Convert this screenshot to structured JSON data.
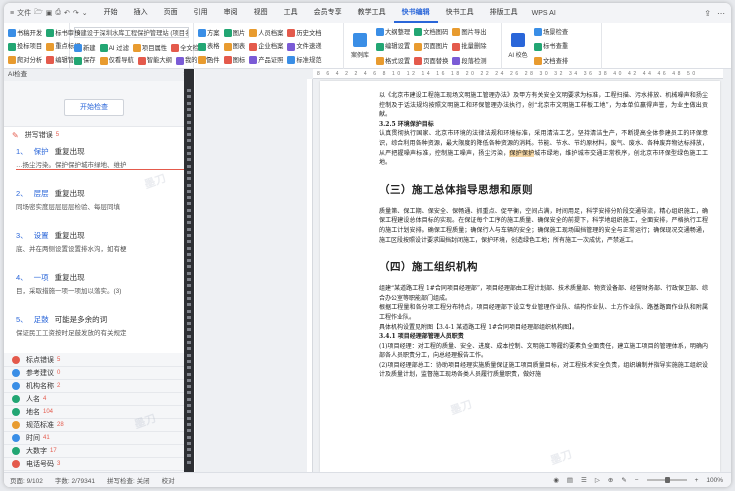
{
  "menubar": {
    "file_label": "文件",
    "tabs": [
      "开始",
      "插入",
      "页面",
      "引用",
      "审阅",
      "视图",
      "工具",
      "会员专享",
      "教学工具",
      "快书编辑",
      "快书工具",
      "排版工具"
    ],
    "active_tab": "快书编辑",
    "wps_ai": "WPS AI"
  },
  "ribbon": {
    "g1": [
      [
        "书稿开发",
        "标书审核"
      ],
      [
        "投标项目",
        "重点标记"
      ],
      [
        "爬对分析",
        "编辑管理"
      ]
    ],
    "g2_title": "快书编辑 (双击选择)",
    "g2_top": "9建设于深圳水库工程保护管理站 (项目名称)",
    "g2_rows": [
      [
        "新建",
        "AI 过滤",
        "项目属性",
        "全文检索"
      ],
      [
        "保存",
        "仅看导航",
        "智能大纲",
        "我的工作"
      ]
    ],
    "g3": [
      [
        "方案",
        "图片",
        "人员档案",
        "历史文档"
      ],
      [
        "表格",
        "图表",
        "企业档案",
        "文件速递"
      ],
      [
        "函件",
        "图标",
        "产品证照",
        "标准规范"
      ]
    ],
    "g4_big": "案例库",
    "g4": [
      [
        "大纲整理",
        "文档图码",
        "图片导出"
      ],
      [
        "编辑设置",
        "页面图片",
        "批量删除"
      ],
      [
        "格式设置",
        "页面替换",
        "段落检测"
      ]
    ],
    "g5_big": "AI 校色",
    "g5": [
      [
        "场景检查"
      ],
      [
        "标书查重"
      ],
      [
        "文档查排"
      ]
    ]
  },
  "panel": {
    "title": "AI检查",
    "close": "×",
    "check_button": "开始检查",
    "spelling_cat": "拼写错误",
    "spelling_count": "5",
    "errors": [
      {
        "num": "1、",
        "word": "保护",
        "type": "重复出现",
        "ctx": "…扬尘污染。保护保护城市绿地、维护"
      },
      {
        "num": "2、",
        "word": "层层",
        "type": "重复出现",
        "ctx": "同场密实度层层层层检验、每层同填"
      },
      {
        "num": "3、",
        "word": "设置",
        "type": "重复出现",
        "ctx": "底、并在两侧设置设置排水沟，如有梗"
      },
      {
        "num": "4、",
        "word": "一项",
        "type": "重复出现",
        "ctx": "目，采取措施一项一项加以落实。(3)"
      },
      {
        "num": "5、",
        "word": "足鼓",
        "type": "可能是多余的词",
        "ctx": "保证民工工资按时足鼓发放的有关规定"
      }
    ],
    "categories": [
      {
        "label": "标点错误",
        "count": "5",
        "color": "#e45a4c"
      },
      {
        "label": "参考建议",
        "count": "0",
        "color": "#3a8ee6"
      },
      {
        "label": "机构名称",
        "count": "2",
        "color": "#3a8ee6"
      },
      {
        "label": "人名",
        "count": "4",
        "color": "#22a673"
      },
      {
        "label": "地名",
        "count": "104",
        "color": "#22a673"
      },
      {
        "label": "规范标准",
        "count": "28",
        "color": "#e89b2f"
      },
      {
        "label": "时间",
        "count": "41",
        "color": "#3a8ee6"
      },
      {
        "label": "大数字",
        "count": "17",
        "color": "#22a673"
      },
      {
        "label": "电话号码",
        "count": "3",
        "color": "#e45a4c"
      }
    ]
  },
  "document": {
    "ruler": "8 6 4 2 2 4 6 8 10 12 14 16 18 20 22 24 26 28 30 32 34 36 38 40 42 44 46 48 50",
    "p1": "以《北京市建设工程施工现场文明施工管理办法》及甲方有关安全文明要求为标准，工程扫描、污水排放、机械噪声和扬尘控制及于话法规均按照文明施工和环保管理办法执行，创“北京市文明施工样板工地”，为本单位赢得声誉，为业主做出贡献。",
    "p1_sub": "3.2.5 环境保护目标",
    "p2_a": "认真贯彻执行国家、北京市环境的法律法规和环境标准，采用清洁工艺，坚持清洁生产，不断提高全体参建员工的环保意识，综合利用各种资源，最大限度的降低各种资源的消耗。节能、节水、节约原材料，废气、废水、各种废弃物达标排放，从严把握噪声标准，控制施工噪声，扬尘污染，",
    "p2_hl": "保护保护",
    "p2_b": "城市绿地，维护城市交通正常秩序，创北京市环保型绿色施工工地。",
    "h_3": "（三）施工总体指导思想和原则",
    "p3": "质量第、保工期、保安全、保畅通、抓重点、促平衡，空间占满，时间用足，科学安排分阶段交通导流，精心组织施工，确保工程建设总体目标的实现。在保证每个工序的施工质量、确保安全的前提下，科学地组织施工，全面安排，严格执行工程的施工计划安排。确保工程质量；确保行人与车辆的安全；确保施工现场围挡管理的安全与正常运行；确保现况交通畅通，施工区段按照设计要求围挡封闭施工，保护环境，创造绿色工地；所有施工一次成优，严禁返工。",
    "h_4": "（四）施工组织机构",
    "p4": "组建“某道路工程 1#合同项目经理部”，项目经理部由工程计划部、技术质量部、物资设备部、经营财务部、行政保卫部、综合办公室等职能部门组成。",
    "p5": "根据工程量和各分项工程分布特点，项目经理部下设立专业管理作业队、结构作业队、土方作业队、路基路面作业队和附属工程作业队。",
    "p6": "具体机构设置见附图【3.4-1 某道路工程 1#合同项目经理部组织机构图】。",
    "p6_sub": "3.4.1 项目经理部管理人员职责",
    "p7": "(1)项目经理：对工程的质量、安全、进度、成本控制、文明施工等履约要素负全面责任，建立施工项目的管理体系，明确内部各人员职责分工，向总经理报告工作。",
    "p8": "(2)项目经理部总工：协助项目经理实施质量保证施工项目质量目标，对工程技术安全负责，组织编制并指导实施施工组织设计及质量计划，监督施工现场各类人员履行质量职责，做好施"
  },
  "status": {
    "page": "页面: 9/102",
    "words": "字数: 2/79341",
    "spell": "拼写检查: 关闭",
    "proof": "校对",
    "zoom": "100%"
  },
  "watermark": "墨刀"
}
